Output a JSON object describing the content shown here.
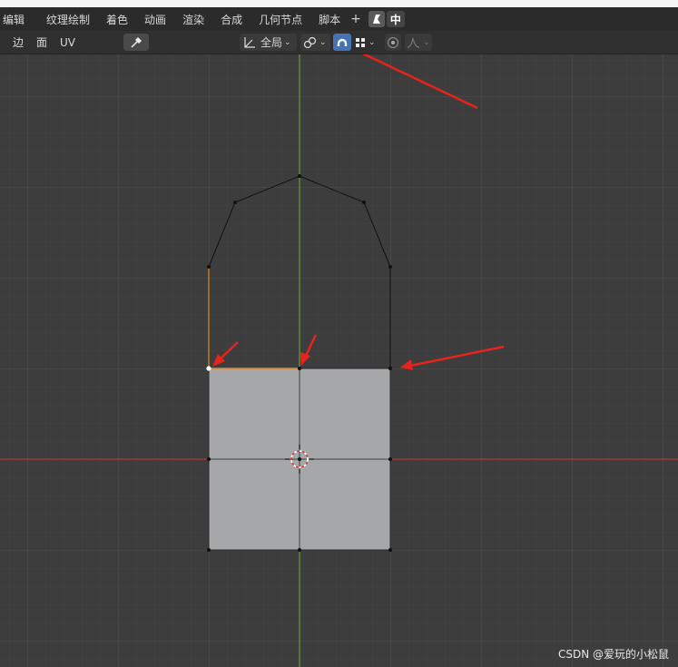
{
  "menubar": {
    "items": [
      "编辑",
      "纹理绘制",
      "着色",
      "动画",
      "渲染",
      "合成",
      "几何节点",
      "脚本"
    ],
    "plus": "+",
    "lang": "中"
  },
  "toolbar": {
    "select_edge": "边",
    "select_face": "面",
    "uv": "UV",
    "transform_orientation": "全局",
    "eyedropper_icon": "eyedropper-icon",
    "pivot_icon": "pivot-icon",
    "snap_icon": "magnet-icon",
    "snap_active": true,
    "proportional_icon": "proportional-edit-icon",
    "falloff_icon": "falloff-curve-icon"
  },
  "colors": {
    "background": "#3d3d3d",
    "grid": "#4a4a4a",
    "x_axis": "#b03a3a",
    "y_axis": "#6e9a3a",
    "face_fill": "#a6a7a9",
    "selected_edge": "#e08a2a",
    "annotation_arrow": "#e8231c",
    "snap_active": "#4772b3"
  },
  "watermark": "CSDN @爱玩的小松鼠"
}
